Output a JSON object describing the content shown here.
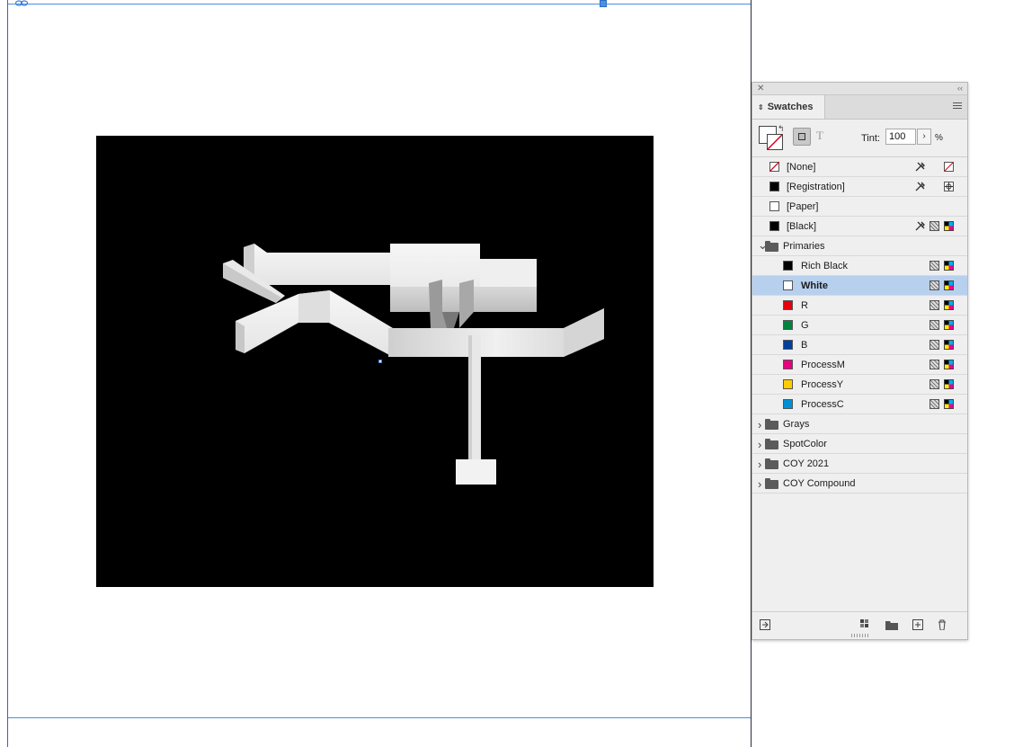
{
  "panel": {
    "title": "Swatches",
    "tint_label": "Tint:",
    "tint_value": "100",
    "tint_unit": "%",
    "text_button_glyph": "T"
  },
  "swatches": [
    {
      "label": "[None]",
      "chip": "none",
      "icons": [
        "no-edit-icon",
        "none-mode-icon"
      ]
    },
    {
      "label": "[Registration]",
      "chip": "#000000",
      "icons": [
        "no-edit-icon",
        "registration-mode-icon"
      ]
    },
    {
      "label": "[Paper]",
      "chip": "#ffffff",
      "icons": []
    },
    {
      "label": "[Black]",
      "chip": "#000000",
      "icons": [
        "no-edit-icon",
        "process-icon",
        "cmyk-icon"
      ]
    }
  ],
  "groups": [
    {
      "name": "Primaries",
      "expanded": true,
      "items": [
        {
          "label": "Rich Black",
          "color": "#000000",
          "selected": false
        },
        {
          "label": "White",
          "color": "#ffffff",
          "selected": true
        },
        {
          "label": "R",
          "color": "#e3000f",
          "selected": false
        },
        {
          "label": "G",
          "color": "#00843d",
          "selected": false
        },
        {
          "label": "B",
          "color": "#003f9e",
          "selected": false
        },
        {
          "label": "ProcessM",
          "color": "#e6007e",
          "selected": false
        },
        {
          "label": "ProcessY",
          "color": "#ffcc00",
          "selected": false
        },
        {
          "label": "ProcessC",
          "color": "#0090d4",
          "selected": false
        }
      ]
    },
    {
      "name": "Grays",
      "expanded": false
    },
    {
      "name": "SpotColor",
      "expanded": false
    },
    {
      "name": "COY 2021",
      "expanded": false
    },
    {
      "name": "COY Compound",
      "expanded": false
    }
  ],
  "colors": {
    "accent": "#4a8fe0",
    "selection": "#b7d0ee",
    "panel_bg": "#efefef",
    "image_bg": "#000000"
  }
}
